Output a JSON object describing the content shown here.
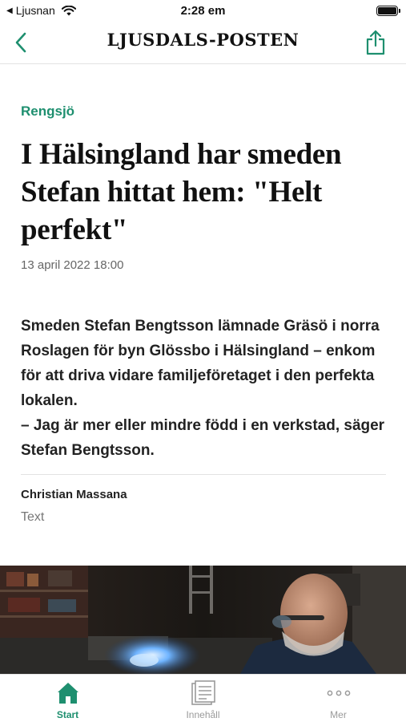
{
  "status_bar": {
    "carrier_back": "Ljusnan",
    "time": "2:28 em",
    "icons": [
      "back-triangle-icon",
      "wifi-icon",
      "battery-icon"
    ]
  },
  "nav": {
    "logo": "LJUSDALS-POSTEN",
    "back_icon": "chevron-left-icon",
    "share_icon": "share-icon"
  },
  "article": {
    "section": "Rengsjö",
    "headline": "I Hälsingland har smeden Stefan hittat hem: \"Helt perfekt\"",
    "date": "13 april 2022 18:00",
    "lead": "Smeden Stefan Bengtsson lämnade Gräsö i norra Roslagen för byn Glössbo i Hälsingland – enkom för att driva vidare familjeföretaget i den perfekta lokalen.\n– Jag är mer eller mindre född i en verkstad, säger Stefan Bengtsson.",
    "author": "Christian Massana",
    "author_role": "Text"
  },
  "tabs": [
    {
      "label": "Start",
      "icon": "home-icon",
      "active": true
    },
    {
      "label": "Innehåll",
      "icon": "document-icon",
      "active": false
    },
    {
      "label": "Mer",
      "icon": "more-dots-icon",
      "active": false
    }
  ],
  "colors": {
    "accent": "#1e8f6f",
    "text": "#111111",
    "muted": "#666666"
  }
}
